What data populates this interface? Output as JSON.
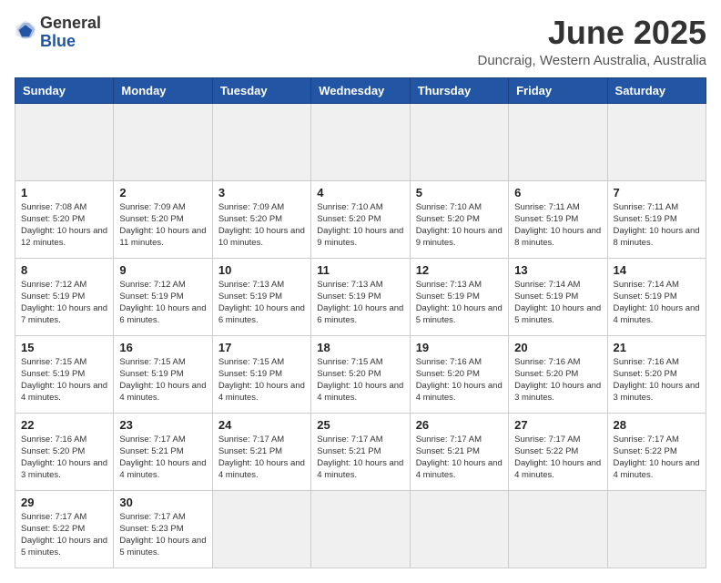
{
  "header": {
    "logo_general": "General",
    "logo_blue": "Blue",
    "title": "June 2025",
    "location": "Duncraig, Western Australia, Australia"
  },
  "calendar": {
    "days_of_week": [
      "Sunday",
      "Monday",
      "Tuesday",
      "Wednesday",
      "Thursday",
      "Friday",
      "Saturday"
    ],
    "weeks": [
      [
        {
          "day": "",
          "empty": true
        },
        {
          "day": "",
          "empty": true
        },
        {
          "day": "",
          "empty": true
        },
        {
          "day": "",
          "empty": true
        },
        {
          "day": "",
          "empty": true
        },
        {
          "day": "",
          "empty": true
        },
        {
          "day": "",
          "empty": true
        }
      ],
      [
        {
          "day": "1",
          "sunrise": "7:08 AM",
          "sunset": "5:20 PM",
          "daylight": "10 hours and 12 minutes."
        },
        {
          "day": "2",
          "sunrise": "7:09 AM",
          "sunset": "5:20 PM",
          "daylight": "10 hours and 11 minutes."
        },
        {
          "day": "3",
          "sunrise": "7:09 AM",
          "sunset": "5:20 PM",
          "daylight": "10 hours and 10 minutes."
        },
        {
          "day": "4",
          "sunrise": "7:10 AM",
          "sunset": "5:20 PM",
          "daylight": "10 hours and 9 minutes."
        },
        {
          "day": "5",
          "sunrise": "7:10 AM",
          "sunset": "5:20 PM",
          "daylight": "10 hours and 9 minutes."
        },
        {
          "day": "6",
          "sunrise": "7:11 AM",
          "sunset": "5:19 PM",
          "daylight": "10 hours and 8 minutes."
        },
        {
          "day": "7",
          "sunrise": "7:11 AM",
          "sunset": "5:19 PM",
          "daylight": "10 hours and 8 minutes."
        }
      ],
      [
        {
          "day": "8",
          "sunrise": "7:12 AM",
          "sunset": "5:19 PM",
          "daylight": "10 hours and 7 minutes."
        },
        {
          "day": "9",
          "sunrise": "7:12 AM",
          "sunset": "5:19 PM",
          "daylight": "10 hours and 6 minutes."
        },
        {
          "day": "10",
          "sunrise": "7:13 AM",
          "sunset": "5:19 PM",
          "daylight": "10 hours and 6 minutes."
        },
        {
          "day": "11",
          "sunrise": "7:13 AM",
          "sunset": "5:19 PM",
          "daylight": "10 hours and 6 minutes."
        },
        {
          "day": "12",
          "sunrise": "7:13 AM",
          "sunset": "5:19 PM",
          "daylight": "10 hours and 5 minutes."
        },
        {
          "day": "13",
          "sunrise": "7:14 AM",
          "sunset": "5:19 PM",
          "daylight": "10 hours and 5 minutes."
        },
        {
          "day": "14",
          "sunrise": "7:14 AM",
          "sunset": "5:19 PM",
          "daylight": "10 hours and 4 minutes."
        }
      ],
      [
        {
          "day": "15",
          "sunrise": "7:15 AM",
          "sunset": "5:19 PM",
          "daylight": "10 hours and 4 minutes."
        },
        {
          "day": "16",
          "sunrise": "7:15 AM",
          "sunset": "5:19 PM",
          "daylight": "10 hours and 4 minutes."
        },
        {
          "day": "17",
          "sunrise": "7:15 AM",
          "sunset": "5:19 PM",
          "daylight": "10 hours and 4 minutes."
        },
        {
          "day": "18",
          "sunrise": "7:15 AM",
          "sunset": "5:20 PM",
          "daylight": "10 hours and 4 minutes."
        },
        {
          "day": "19",
          "sunrise": "7:16 AM",
          "sunset": "5:20 PM",
          "daylight": "10 hours and 4 minutes."
        },
        {
          "day": "20",
          "sunrise": "7:16 AM",
          "sunset": "5:20 PM",
          "daylight": "10 hours and 3 minutes."
        },
        {
          "day": "21",
          "sunrise": "7:16 AM",
          "sunset": "5:20 PM",
          "daylight": "10 hours and 3 minutes."
        }
      ],
      [
        {
          "day": "22",
          "sunrise": "7:16 AM",
          "sunset": "5:20 PM",
          "daylight": "10 hours and 3 minutes."
        },
        {
          "day": "23",
          "sunrise": "7:17 AM",
          "sunset": "5:21 PM",
          "daylight": "10 hours and 4 minutes."
        },
        {
          "day": "24",
          "sunrise": "7:17 AM",
          "sunset": "5:21 PM",
          "daylight": "10 hours and 4 minutes."
        },
        {
          "day": "25",
          "sunrise": "7:17 AM",
          "sunset": "5:21 PM",
          "daylight": "10 hours and 4 minutes."
        },
        {
          "day": "26",
          "sunrise": "7:17 AM",
          "sunset": "5:21 PM",
          "daylight": "10 hours and 4 minutes."
        },
        {
          "day": "27",
          "sunrise": "7:17 AM",
          "sunset": "5:22 PM",
          "daylight": "10 hours and 4 minutes."
        },
        {
          "day": "28",
          "sunrise": "7:17 AM",
          "sunset": "5:22 PM",
          "daylight": "10 hours and 4 minutes."
        }
      ],
      [
        {
          "day": "29",
          "sunrise": "7:17 AM",
          "sunset": "5:22 PM",
          "daylight": "10 hours and 5 minutes."
        },
        {
          "day": "30",
          "sunrise": "7:17 AM",
          "sunset": "5:23 PM",
          "daylight": "10 hours and 5 minutes."
        },
        {
          "day": "",
          "empty": true
        },
        {
          "day": "",
          "empty": true
        },
        {
          "day": "",
          "empty": true
        },
        {
          "day": "",
          "empty": true
        },
        {
          "day": "",
          "empty": true
        }
      ]
    ]
  }
}
